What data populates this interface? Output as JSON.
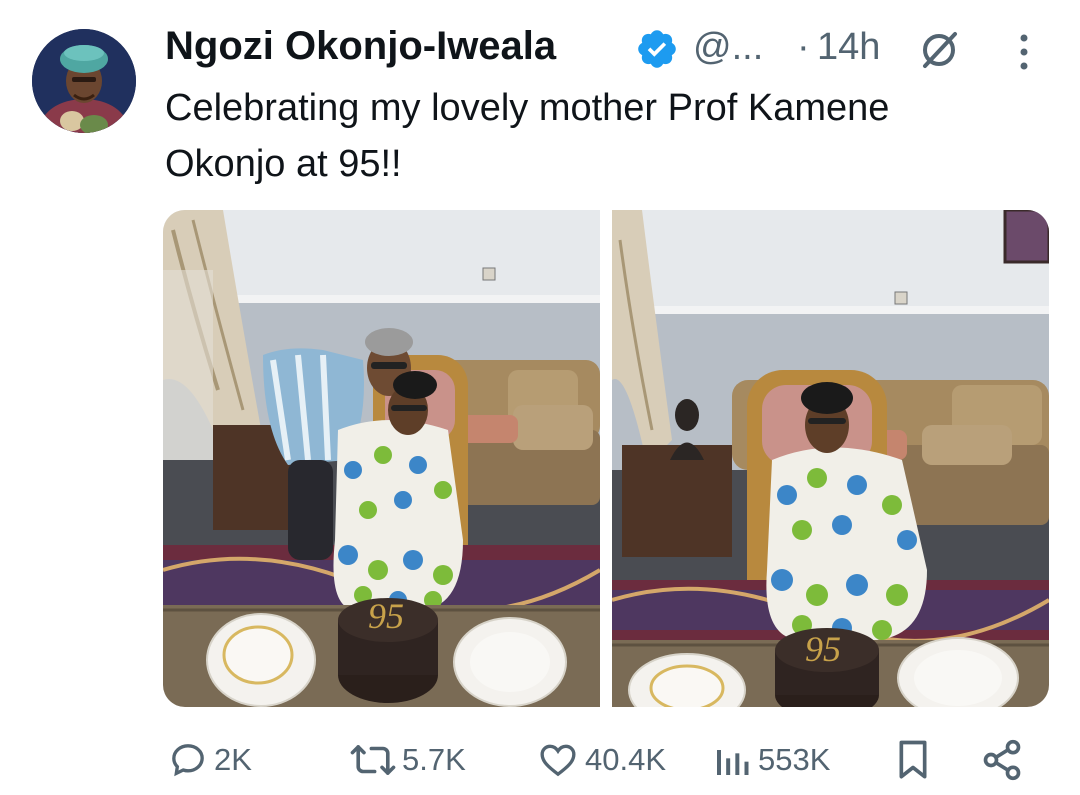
{
  "tweet": {
    "author_name": "Ngozi Okonjo-Iweala",
    "handle": "@...",
    "separator": "·",
    "timestamp": "14h",
    "text": "Celebrating my lovely mother Prof Kamene Okonjo at 95!!",
    "cake_number": "95"
  },
  "actions": {
    "replies": "2K",
    "reposts": "5.7K",
    "likes": "40.4K",
    "views": "553K"
  },
  "icons": [
    "avatar",
    "verified-badge-icon",
    "grok-icon",
    "more-icon",
    "reply-icon",
    "repost-icon",
    "like-icon",
    "views-icon",
    "bookmark-icon",
    "share-icon"
  ],
  "colors": {
    "verified": "#1d9bf0",
    "muted": "#536471",
    "text": "#0f1419"
  }
}
